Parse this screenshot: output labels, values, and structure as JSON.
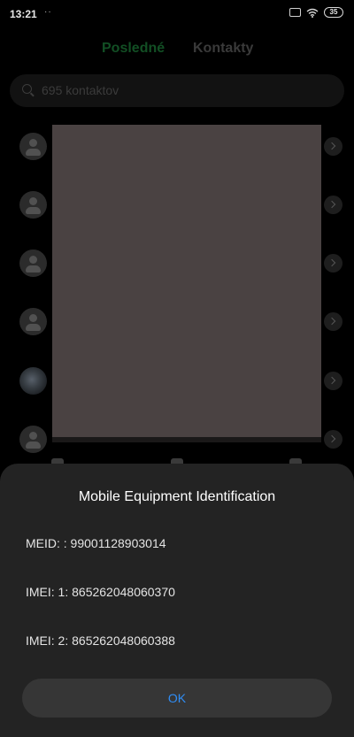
{
  "status_bar": {
    "time": "13:21",
    "notification_dots": "··",
    "battery_level": "35",
    "icons": [
      "sim-card-icon",
      "wifi-icon",
      "battery-icon"
    ]
  },
  "tabs": [
    {
      "label": "Posledné",
      "active": true
    },
    {
      "label": "Kontakty",
      "active": false
    }
  ],
  "search": {
    "placeholder": "695 kontaktov",
    "icon": "search-icon"
  },
  "contacts": {
    "avatars": [
      "default-avatar-icon",
      "default-avatar-icon",
      "default-avatar-icon",
      "default-avatar-icon",
      "photo-avatar",
      "default-avatar-icon"
    ],
    "detail_icon": "chevron-right-icon"
  },
  "dialog": {
    "title": "Mobile Equipment Identification",
    "lines": [
      "MEID: : 99001128903014",
      "IMEI: 1: 865262048060370",
      "IMEI: 2: 865262048060388"
    ],
    "ok_label": "OK"
  },
  "colors": {
    "accent_green": "#1aa640",
    "ok_blue": "#2f8df5",
    "dialog_bg": "#232323",
    "redaction": "#4a4242"
  }
}
